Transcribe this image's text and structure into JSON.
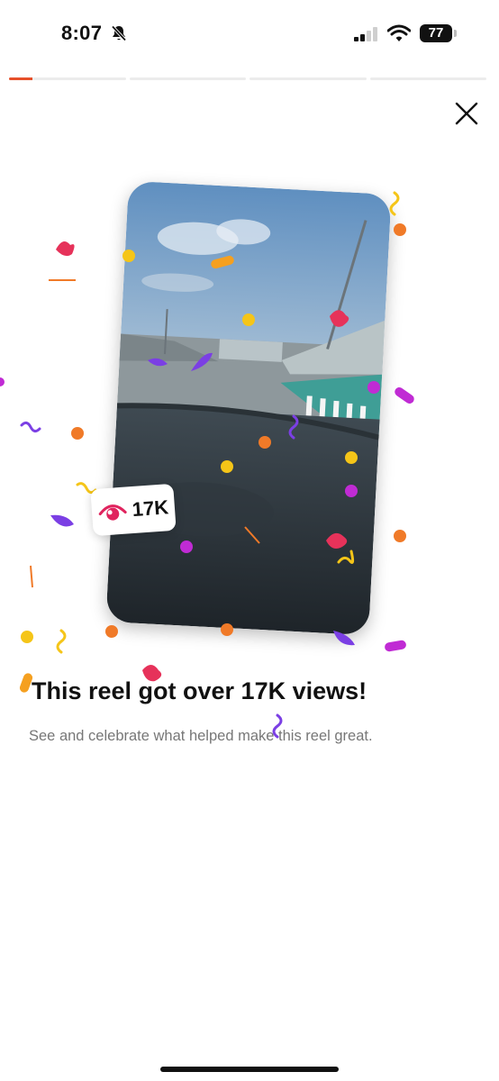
{
  "status_bar": {
    "time": "8:07",
    "battery": "77"
  },
  "progress": {
    "segments": 4,
    "current_fill": 0.2
  },
  "reel": {
    "views_badge": "17K"
  },
  "headline": "This reel got over 17K views!",
  "subtext": "See and celebrate what helped make this reel great.",
  "colors": {
    "accent": "#e6502a",
    "eye": "#e0245e",
    "purple": "#7b3fe4",
    "magenta": "#c02bd4",
    "yellow": "#f5c518",
    "orange": "#f07a28",
    "pink": "#e6325a"
  },
  "icons": [
    "bell-slash-icon",
    "signal-icon",
    "wifi-icon",
    "battery-icon",
    "close-icon",
    "eye-icon"
  ]
}
